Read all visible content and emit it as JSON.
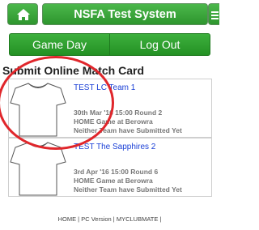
{
  "header": {
    "title": "NSFA Test System",
    "home_icon": "home-icon",
    "menu_icon": "menu-icon"
  },
  "nav": {
    "game_day": "Game Day",
    "log_out": "Log Out"
  },
  "page": {
    "title": "Submit Online Match Card"
  },
  "matches": [
    {
      "team": "TEST LC Team 1",
      "date_round": "30th Mar '16 15:00 Round 2",
      "venue": "HOME Game at Berowra",
      "status": "Neither Team have Submitted Yet"
    },
    {
      "team": "TEST The Sapphires 2",
      "date_round": "3rd Apr '16 15:00 Round 6",
      "venue": "HOME Game at Berowra",
      "status": "Neither Team have Submitted Yet"
    }
  ],
  "footer": {
    "text": "HOME | PC Version | MYCLUBMATE |"
  },
  "colors": {
    "accent": "#2e962e",
    "link": "#1a3fd6",
    "annotation": "#e0262b"
  }
}
